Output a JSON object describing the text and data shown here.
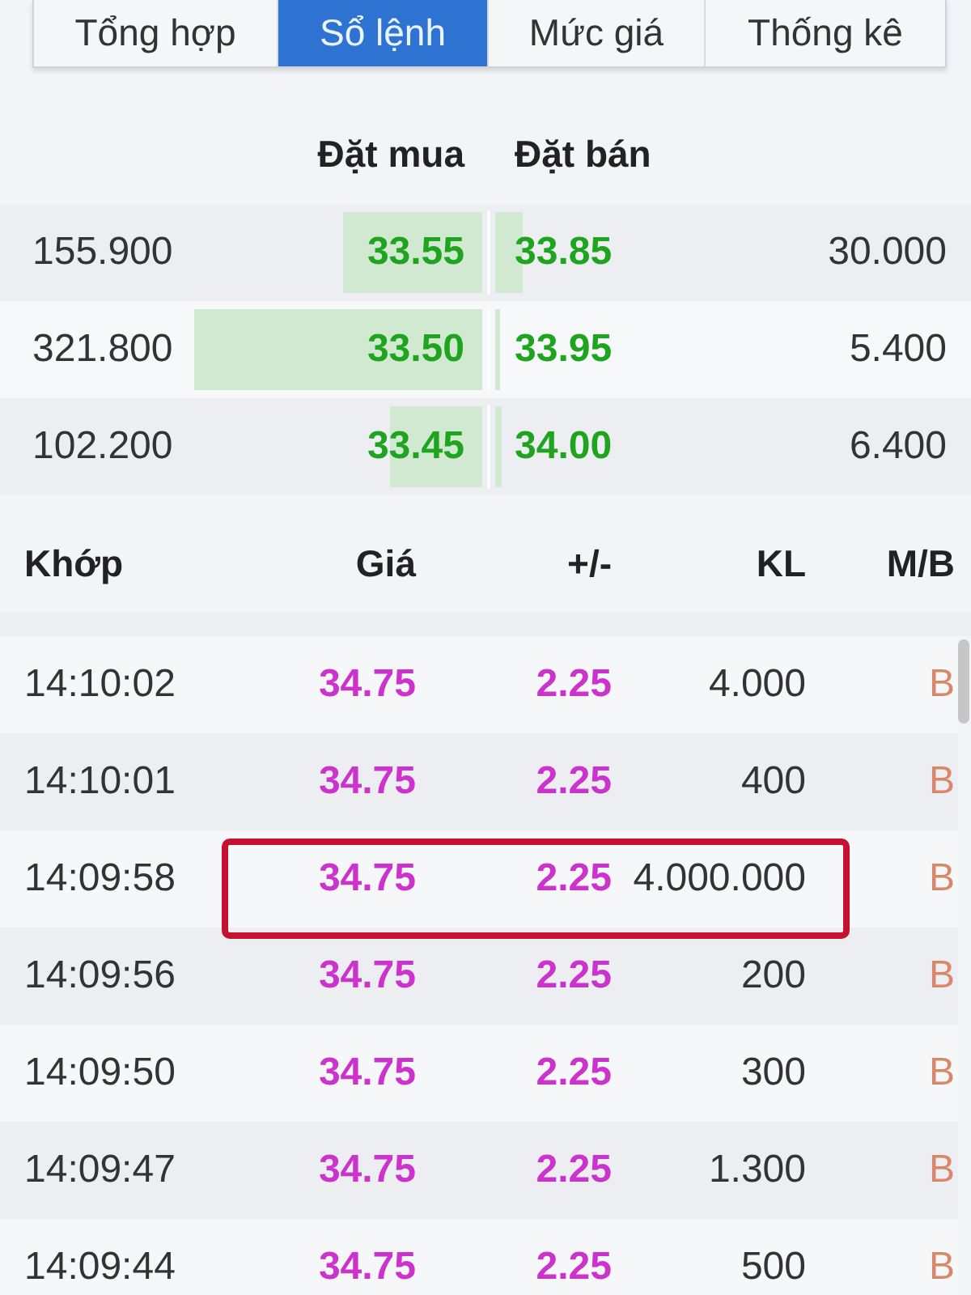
{
  "tabs": [
    {
      "label": "Tổng hợp",
      "selected": false
    },
    {
      "label": "Sổ lệnh",
      "selected": true
    },
    {
      "label": "Mức giá",
      "selected": false
    },
    {
      "label": "Thống kê",
      "selected": false
    }
  ],
  "order_book": {
    "columns": [
      "Đặt mua",
      "Đặt bán"
    ],
    "rows": [
      {
        "bid": {
          "volume": "155.900",
          "price": "33.55"
        },
        "ask": {
          "price": "33.85",
          "volume": "30.000"
        }
      },
      {
        "bid": {
          "volume": "321.800",
          "price": "33.50"
        },
        "ask": {
          "price": "33.95",
          "volume": "5.400"
        }
      },
      {
        "bid": {
          "volume": "102.200",
          "price": "33.45"
        },
        "ask": {
          "price": "34.00",
          "volume": "6.400"
        }
      }
    ]
  },
  "trades": {
    "columns": [
      "Khớp",
      "Giá",
      "+/-",
      "KL",
      "M/B"
    ],
    "rows": [
      {
        "time": "14:10:02",
        "price": "34.75",
        "change": "2.25",
        "volume": "4.000",
        "side": "B",
        "highlighted": false
      },
      {
        "time": "14:10:01",
        "price": "34.75",
        "change": "2.25",
        "volume": "400",
        "side": "B",
        "highlighted": false
      },
      {
        "time": "14:09:58",
        "price": "34.75",
        "change": "2.25",
        "volume": "4.000.000",
        "side": "B",
        "highlighted": true
      },
      {
        "time": "14:09:56",
        "price": "34.75",
        "change": "2.25",
        "volume": "200",
        "side": "B",
        "highlighted": false
      },
      {
        "time": "14:09:50",
        "price": "34.75",
        "change": "2.25",
        "volume": "300",
        "side": "B",
        "highlighted": false
      },
      {
        "time": "14:09:47",
        "price": "34.75",
        "change": "2.25",
        "volume": "1.300",
        "side": "B",
        "highlighted": false
      },
      {
        "time": "14:09:44",
        "price": "34.75",
        "change": "2.25",
        "volume": "500",
        "side": "B",
        "highlighted": false
      }
    ]
  }
}
